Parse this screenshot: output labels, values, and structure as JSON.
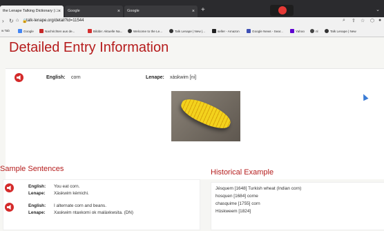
{
  "browser": {
    "tabs": [
      {
        "title": "the Lenape Talking Dictionary | □",
        "active": true
      },
      {
        "title": "Google",
        "active": false
      },
      {
        "title": "Google",
        "active": false
      }
    ],
    "url": "talk-lenape.org/detail?id=11544",
    "bookmarks": [
      "w Tab",
      "Google",
      "Nachrichten aus de...",
      "Bildde: Aktuelle Na...",
      "Welcome to the Le...",
      "Talk Lenape | New |...",
      "seller - Amazon",
      "Google News - Sear...",
      "Yahoo",
      "nl",
      "Talk Lenape | New"
    ],
    "tab_close": "×",
    "new_tab": "+"
  },
  "page": {
    "title": "Detailed Entry Information",
    "entry": {
      "english_label": "English:",
      "english_value": "corn",
      "lenape_label": "Lenape:",
      "lenape_value": "xàskwim [ni]"
    },
    "sentences_title": "Sample Sentences",
    "sentences": [
      {
        "english_label": "English:",
        "english": "You eat corn.",
        "lenape_label": "Lenape:",
        "lenape": "Xàskwim kèmichi."
      },
      {
        "english_label": "English:",
        "english": "I alternate corn and beans.",
        "lenape_label": "Lenape:",
        "lenape": "Xaskwim ntaxkomi ok malàxkwsita. (DN)"
      }
    ],
    "historical_title": "Historical Example",
    "historical": [
      "Jésquem [1648] Turkish wheat (Indian corn)",
      "hosquen [1684] corne",
      "chasquime [1755] corn",
      "Hüskweem [1824]"
    ]
  },
  "colors": {
    "accent": "#b51c1c",
    "speaker": "#d42a2a"
  }
}
